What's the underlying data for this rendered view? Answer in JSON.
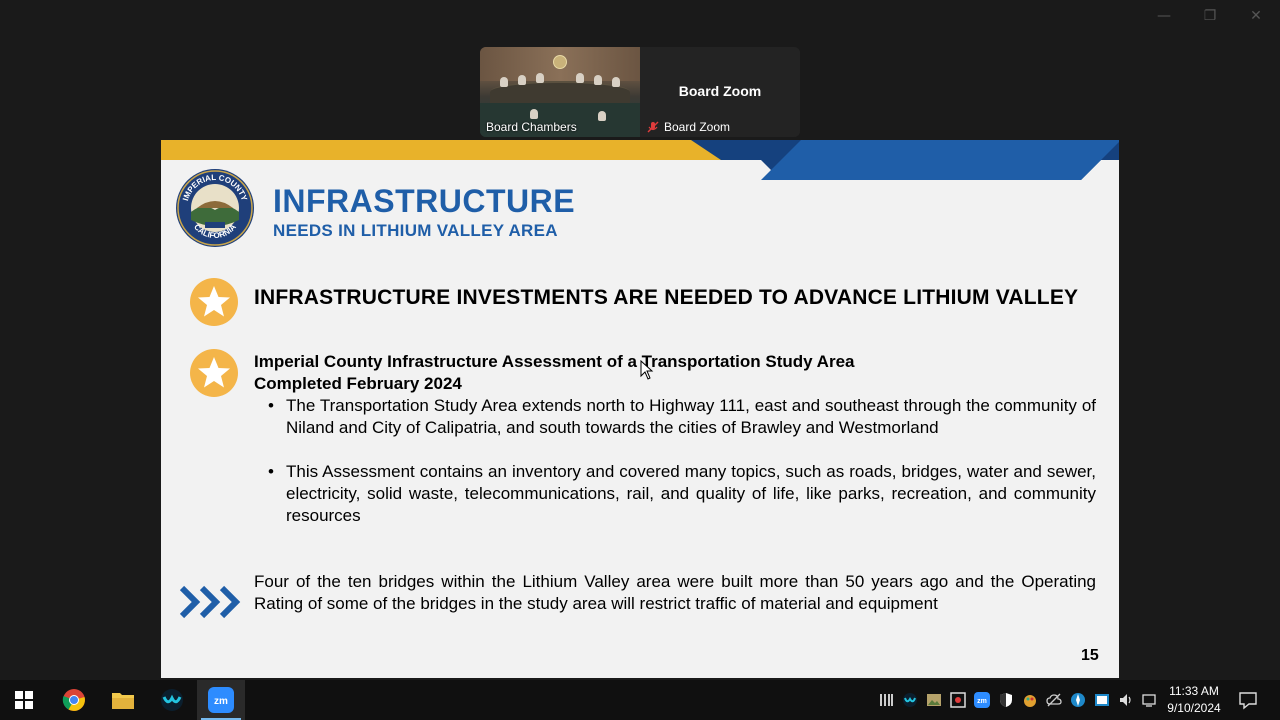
{
  "window": {
    "minimize": "—",
    "maximize": "❐",
    "close": "✕"
  },
  "participants": [
    {
      "label": "Board Chambers"
    },
    {
      "name": "Board Zoom",
      "label": "Board Zoom"
    }
  ],
  "slide": {
    "seal_text": {
      "top": "IMPERIAL COUNTY",
      "bottom": "CALIFORNIA"
    },
    "title": "INFRASTRUCTURE",
    "subtitle": "NEEDS IN LITHIUM VALLEY AREA",
    "headline": "INFRASTRUCTURE INVESTMENTS ARE NEEDED TO ADVANCE LITHIUM VALLEY",
    "item_title_line1": "Imperial County Infrastructure Assessment of a Transportation Study Area",
    "item_title_line2": "Completed February 2024",
    "bullets": [
      "The Transportation Study Area extends north to Highway 111, east and southeast through the community of Niland and City of Calipatria, and south towards the cities of Brawley and Westmorland",
      "This Assessment contains an inventory and covered many topics, such as roads, bridges, water and sewer, electricity, solid waste, telecommunications, rail, and quality of life, like parks, recreation, and community resources"
    ],
    "note": "Four of the ten bridges within the Lithium Valley area were built more than 50 years ago and the Operating Rating of some of the bridges in the study area will restrict traffic of material and equipment",
    "page_number": "15",
    "colors": {
      "gold": "#e8b22a",
      "blue": "#1f5ea8",
      "navy": "#15417e",
      "star_badge": "#f4b549"
    }
  },
  "taskbar": {
    "apps": [
      "windows-start",
      "chrome",
      "file-explorer",
      "webex",
      "zoom"
    ],
    "tray_icons": [
      "bars",
      "webex",
      "image",
      "antivirus",
      "zoom",
      "shield",
      "color-palette",
      "cloud",
      "bluetooth",
      "network-app",
      "speaker",
      "network"
    ],
    "time": "11:33 AM",
    "date": "9/10/2024"
  }
}
